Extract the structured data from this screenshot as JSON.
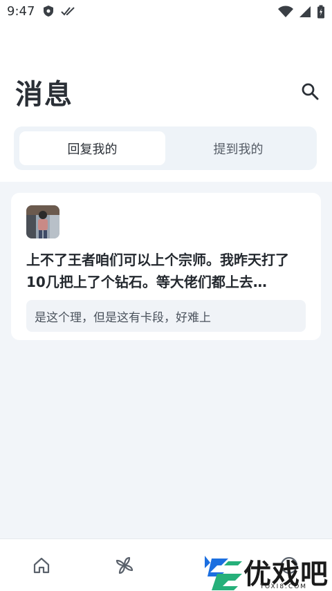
{
  "status_bar": {
    "time": "9:47"
  },
  "header": {
    "title": "消息"
  },
  "tabs": [
    {
      "label": "回复我的",
      "active": true
    },
    {
      "label": "提到我的",
      "active": false
    }
  ],
  "messages": [
    {
      "text": "上不了王者咱们可以上个宗师。我昨天打了10几把上了个钻石。等大佬们都上去…",
      "reply": "是这个理，但是这有卡段，好难上"
    }
  ],
  "watermark": {
    "brand": "优戏吧",
    "domain": "YOXI8.COM"
  },
  "colors": {
    "content_bg": "#f2f5f9",
    "tab_bg": "#eef3f8",
    "accent_blue": "#1c6fe0",
    "accent_green": "#26b07a"
  }
}
